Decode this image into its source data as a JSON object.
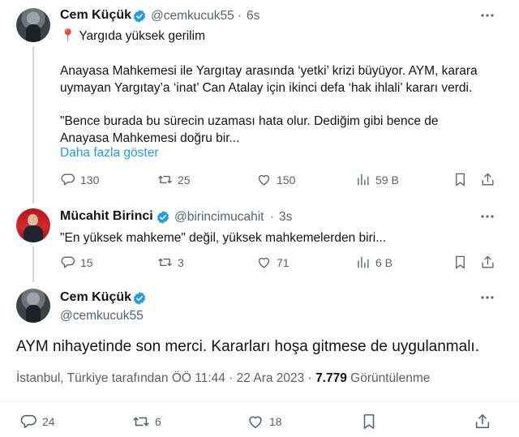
{
  "tweets": [
    {
      "name": "Cem Küçük",
      "handle": "@cemkucuk55",
      "dot": "·",
      "time": "6s",
      "title_emoji": "📍",
      "title": "Yargıda yüksek gerilim",
      "para1_line1": "Anayasa Mahkemesi ile Yargıtay arasında ‘yetki’ krizi büyüyor. AYM, karara",
      "para1_line2": "uymayan Yargıtay’a ‘inat’ Can Atalay için ikinci defa ‘hak ihlali’ kararı verdi.",
      "para2_line1": "\"Bence burada bu sürecin uzaması hata olur. Dediğim gibi bence de",
      "para2_line2": "Anayasa Mahkemesi doğru bir...",
      "show_more": "Daha fazla göster",
      "replies": "130",
      "retweets": "25",
      "likes": "150",
      "views": "59 B"
    },
    {
      "name": "Mücahit Birinci",
      "handle": "@birincimucahit",
      "dot": "·",
      "time": "3s",
      "text": "\"En yüksek mahkeme\" değil, yüksek mahkemelerden biri...",
      "replies": "15",
      "retweets": "3",
      "likes": "71",
      "views": "6 B"
    }
  ],
  "main": {
    "name": "Cem Küçük",
    "handle": "@cemkucuk55",
    "text": "AYM nihayetinde son merci. Kararları hoşa gitmese de uygulanmalı.",
    "meta_location_time": "İstanbul, Türkiye tarafından ÖÖ 11:44 · 22 Ara 2023 ·",
    "views_count": "7.779",
    "views_label": "Görüntülenme",
    "replies": "24",
    "retweets": "6",
    "likes": "18"
  },
  "colors": {
    "verified": "#1d9bf0",
    "text": "#0f1419",
    "secondary": "#536471",
    "link": "#1d9bf0",
    "pin": "#e0245e"
  }
}
